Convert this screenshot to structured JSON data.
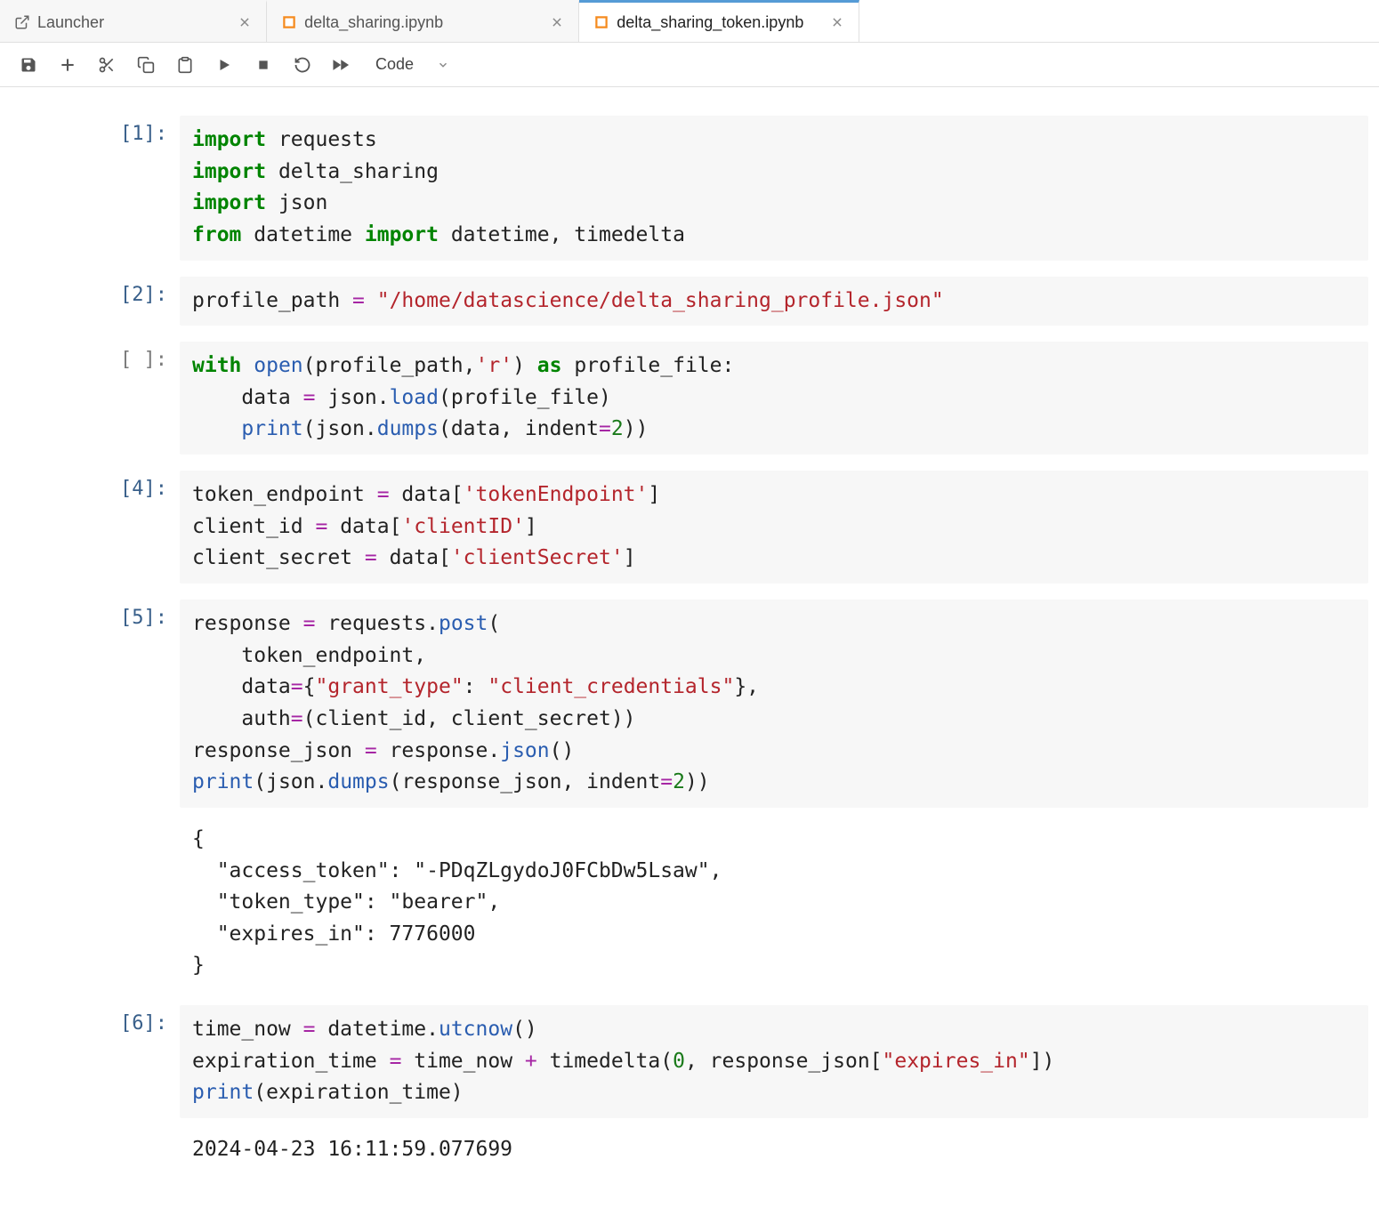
{
  "tabs": [
    {
      "label": "Launcher",
      "icon": "external-link-icon",
      "active": false
    },
    {
      "label": "delta_sharing.ipynb",
      "icon": "notebook-icon",
      "active": false
    },
    {
      "label": "delta_sharing_token.ipynb",
      "icon": "notebook-icon",
      "active": true
    }
  ],
  "toolbar": {
    "cell_type": "Code"
  },
  "cells": [
    {
      "prompt": "[1]:",
      "type": "code",
      "tokens": [
        [
          "kw",
          "import"
        ],
        [
          "",
          " requests\n"
        ],
        [
          "kw",
          "import"
        ],
        [
          "",
          " delta_sharing\n"
        ],
        [
          "kw",
          "import"
        ],
        [
          "",
          " json\n"
        ],
        [
          "kw",
          "from"
        ],
        [
          "",
          " datetime "
        ],
        [
          "kw",
          "import"
        ],
        [
          "",
          " datetime, timedelta"
        ]
      ]
    },
    {
      "prompt": "[2]:",
      "type": "code",
      "tokens": [
        [
          "",
          "profile_path "
        ],
        [
          "op",
          "="
        ],
        [
          "",
          " "
        ],
        [
          "str",
          "\"/home/datascience/delta_sharing_profile.json\""
        ]
      ]
    },
    {
      "prompt": "[ ]:",
      "prompt_empty": true,
      "type": "code",
      "tokens": [
        [
          "kw",
          "with"
        ],
        [
          "",
          " "
        ],
        [
          "fn",
          "open"
        ],
        [
          "",
          "(profile_path,"
        ],
        [
          "str",
          "'r'"
        ],
        [
          "",
          ") "
        ],
        [
          "kw",
          "as"
        ],
        [
          "",
          " profile_file:\n"
        ],
        [
          "",
          "    data "
        ],
        [
          "op",
          "="
        ],
        [
          "",
          " json."
        ],
        [
          "fn",
          "load"
        ],
        [
          "",
          "(profile_file)\n"
        ],
        [
          "",
          "    "
        ],
        [
          "fn",
          "print"
        ],
        [
          "",
          "(json."
        ],
        [
          "fn",
          "dumps"
        ],
        [
          "",
          "(data, indent"
        ],
        [
          "op",
          "="
        ],
        [
          "num",
          "2"
        ],
        [
          "",
          "))"
        ]
      ]
    },
    {
      "prompt": "[4]:",
      "type": "code",
      "tokens": [
        [
          "",
          "token_endpoint "
        ],
        [
          "op",
          "="
        ],
        [
          "",
          " data["
        ],
        [
          "str",
          "'tokenEndpoint'"
        ],
        [
          "",
          "]\n"
        ],
        [
          "",
          "client_id "
        ],
        [
          "op",
          "="
        ],
        [
          "",
          " data["
        ],
        [
          "str",
          "'clientID'"
        ],
        [
          "",
          "]\n"
        ],
        [
          "",
          "client_secret "
        ],
        [
          "op",
          "="
        ],
        [
          "",
          " data["
        ],
        [
          "str",
          "'clientSecret'"
        ],
        [
          "",
          "]"
        ]
      ]
    },
    {
      "prompt": "[5]:",
      "type": "code",
      "tokens": [
        [
          "",
          "response "
        ],
        [
          "op",
          "="
        ],
        [
          "",
          " requests."
        ],
        [
          "fn",
          "post"
        ],
        [
          "",
          "(\n"
        ],
        [
          "",
          "    token_endpoint,\n"
        ],
        [
          "",
          "    data"
        ],
        [
          "op",
          "="
        ],
        [
          "",
          "{"
        ],
        [
          "str",
          "\"grant_type\""
        ],
        [
          "",
          ": "
        ],
        [
          "str",
          "\"client_credentials\""
        ],
        [
          "",
          "},\n"
        ],
        [
          "",
          "    auth"
        ],
        [
          "op",
          "="
        ],
        [
          "",
          "(client_id, client_secret))\n"
        ],
        [
          "",
          "response_json "
        ],
        [
          "op",
          "="
        ],
        [
          "",
          " response."
        ],
        [
          "fn",
          "json"
        ],
        [
          "",
          "()\n"
        ],
        [
          "fn",
          "print"
        ],
        [
          "",
          "(json."
        ],
        [
          "fn",
          "dumps"
        ],
        [
          "",
          "(response_json, indent"
        ],
        [
          "op",
          "="
        ],
        [
          "num",
          "2"
        ],
        [
          "",
          "))"
        ]
      ],
      "output": "{\n  \"access_token\": \"-PDqZLgydoJ0FCbDw5Lsaw\",\n  \"token_type\": \"bearer\",\n  \"expires_in\": 7776000\n}"
    },
    {
      "prompt": "[6]:",
      "type": "code",
      "tokens": [
        [
          "",
          "time_now "
        ],
        [
          "op",
          "="
        ],
        [
          "",
          " datetime."
        ],
        [
          "fn",
          "utcnow"
        ],
        [
          "",
          "()\n"
        ],
        [
          "",
          "expiration_time "
        ],
        [
          "op",
          "="
        ],
        [
          "",
          " time_now "
        ],
        [
          "op",
          "+"
        ],
        [
          "",
          " timedelta("
        ],
        [
          "num",
          "0"
        ],
        [
          "",
          ", response_json["
        ],
        [
          "str",
          "\"expires_in\""
        ],
        [
          "",
          "])\n"
        ],
        [
          "fn",
          "print"
        ],
        [
          "",
          "(expiration_time)"
        ]
      ],
      "output": "2024-04-23 16:11:59.077699"
    }
  ]
}
